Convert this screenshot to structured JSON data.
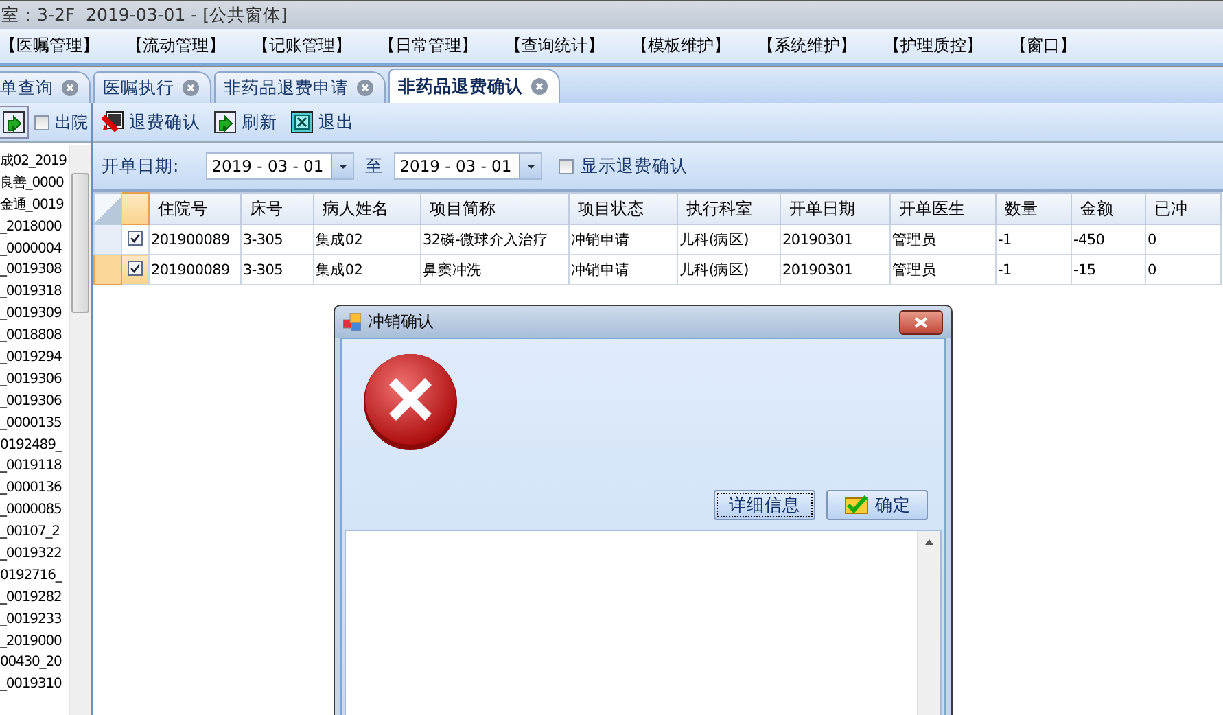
{
  "window": {
    "title": "室：3-2F  2019-03-01 - [公共窗体]"
  },
  "menu": [
    "【医嘱管理】",
    "【流动管理】",
    "【记账管理】",
    "【日常管理】",
    "【查询统计】",
    "【模板维护】",
    "【系统维护】",
    "【护理质控】",
    "【窗口】"
  ],
  "tabs": [
    {
      "label": "单查询",
      "selected": false
    },
    {
      "label": "医嘱执行",
      "selected": false
    },
    {
      "label": "非药品退费申请",
      "selected": false
    },
    {
      "label": "非药品退费确认",
      "selected": true
    }
  ],
  "left_panel": {
    "discharged": {
      "label": "出院",
      "checked": false
    },
    "patients": [
      "成02_2019",
      "良善_0000",
      "金通_0019",
      "_2018000",
      "_0000004",
      "_0019308",
      "_0019318",
      "_0019309",
      "_0018808",
      "_0019294",
      "_0019306",
      "_0019306",
      "_0000135",
      "0192489_",
      "_0019118",
      "_0000136",
      "_0000085",
      "_00107_2",
      "_0019322",
      "0192716_",
      "_0019282",
      "_0019233",
      "_2019000",
      "00430_20",
      "_0019310"
    ]
  },
  "toolbar": [
    {
      "kind": "confirm",
      "label": "退费确认"
    },
    {
      "kind": "refresh",
      "label": "刷新"
    },
    {
      "kind": "exit",
      "label": "退出"
    }
  ],
  "filter": {
    "label": "开单日期:",
    "start_date": "2019 - 03 - 01",
    "separator": "至",
    "end_date": "2019 - 03 - 01",
    "show_confirmed": {
      "label": "显示退费确认",
      "checked": false
    }
  },
  "table": {
    "columns": [
      "住院号",
      "床号",
      "病人姓名",
      "项目简称",
      "项目状态",
      "执行科室",
      "开单日期",
      "开单医生",
      "数量",
      "金额",
      "已冲"
    ],
    "rows": [
      {
        "selected": false,
        "checked": true,
        "cells": [
          "201900089",
          "3-305",
          "集成02",
          "32磷-微球介入治疗",
          "冲销申请",
          "儿科(病区)",
          "20190301",
          "管理员",
          "-1",
          "-450",
          "0"
        ]
      },
      {
        "selected": true,
        "checked": true,
        "cells": [
          "201900089",
          "3-305",
          "集成02",
          "鼻窦冲洗",
          "冲销申请",
          "儿科(病区)",
          "20190301",
          "管理员",
          "-1",
          "-15",
          "0"
        ]
      }
    ]
  },
  "dialog": {
    "title": "冲销确认",
    "buttons": [
      {
        "kind": "details",
        "label": "详细信息"
      },
      {
        "kind": "ok",
        "label": "确定"
      }
    ]
  }
}
